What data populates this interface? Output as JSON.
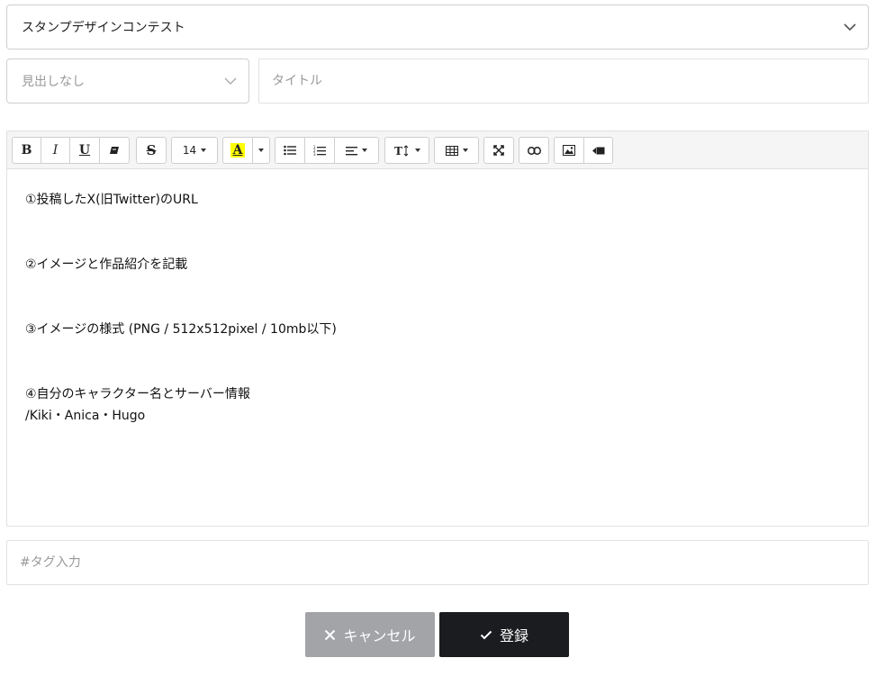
{
  "category_select": {
    "value": "スタンプデザインコンテスト",
    "icon": "chevron-down-icon"
  },
  "heading_select": {
    "value": "見出しなし",
    "icon": "chevron-down-icon"
  },
  "title_input": {
    "placeholder": "タイトル",
    "value": ""
  },
  "toolbar": {
    "bold_label": "B",
    "italic_label": "I",
    "underline_label": "U",
    "strike_label": "S",
    "font_size": "14",
    "font_color_label": "A",
    "font_color_highlight": "#ffff00"
  },
  "editor": {
    "lines": [
      "①投稿したX(旧Twitter)のURL",
      "",
      "",
      "②イメージと作品紹介を記載",
      "",
      "",
      "③イメージの様式 (PNG / 512x512pixel / 10mb以下)",
      "",
      "",
      "④自分のキャラクター名とサーバー情報",
      "/Kiki・Anica・Hugo"
    ]
  },
  "tag_input": {
    "placeholder": "#タグ入力",
    "value": ""
  },
  "actions": {
    "cancel_label": "キャンセル",
    "submit_label": "登録"
  },
  "colors": {
    "cancel_bg": "#a3a4a8",
    "submit_bg": "#1b1c1f",
    "toolbar_bg": "#f5f5f5"
  }
}
